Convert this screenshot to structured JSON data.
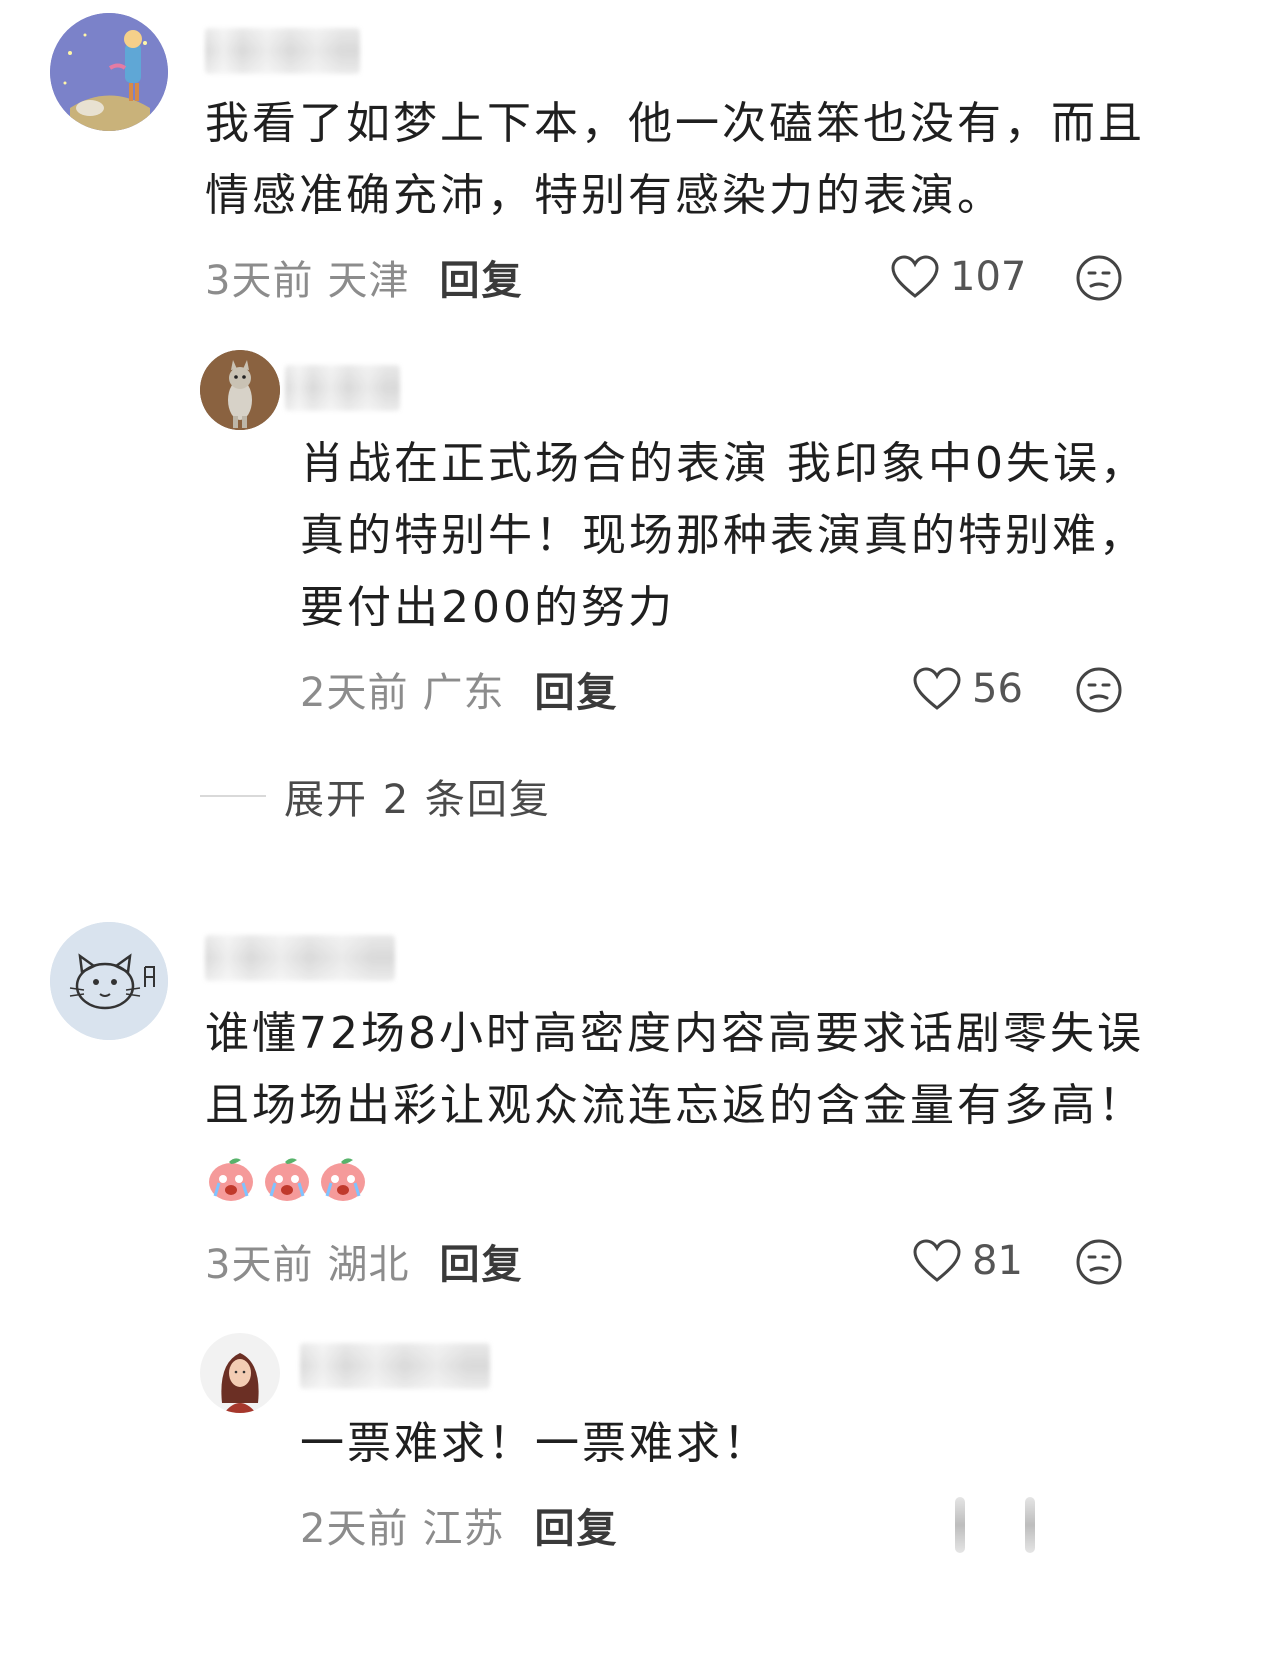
{
  "comments": [
    {
      "text_lines": [
        "我看了如梦上下本，他一次磕笨也没有，而且",
        "情感准确充沛，特别有感染力的表演。"
      ],
      "time": "3天前",
      "location": "天津",
      "reply_label": "回复",
      "likes": "107",
      "avatar_icon": "little-prince-avatar"
    },
    {
      "text_lines": [
        "肖战在正式场合的表演 我印象中0失误，",
        "真的特别牛！现场那种表演真的特别难，",
        "要付出200的努力"
      ],
      "time": "2天前",
      "location": "广东",
      "reply_label": "回复",
      "likes": "56",
      "avatar_icon": "kitten-avatar"
    },
    {
      "text_lines": [
        "谁懂72场8小时高密度内容高要求话剧零失误",
        "且场场出彩让观众流连忘返的含金量有多高！"
      ],
      "emojis": [
        "crying-peach-emoji",
        "crying-peach-emoji",
        "crying-peach-emoji"
      ],
      "time": "3天前",
      "location": "湖北",
      "reply_label": "回复",
      "likes": "81",
      "avatar_icon": "cat-sketch-avatar"
    },
    {
      "text_lines": [
        "一票难求！一票难求！"
      ],
      "time": "2天前",
      "location": "江苏",
      "reply_label": "回复",
      "avatar_icon": "woman-avatar"
    }
  ],
  "expand_replies": "展开 2 条回复",
  "colors": {
    "meta_gray": "#8c8c8c",
    "text": "#1f1f1f",
    "reply": "#3a3a3a"
  }
}
